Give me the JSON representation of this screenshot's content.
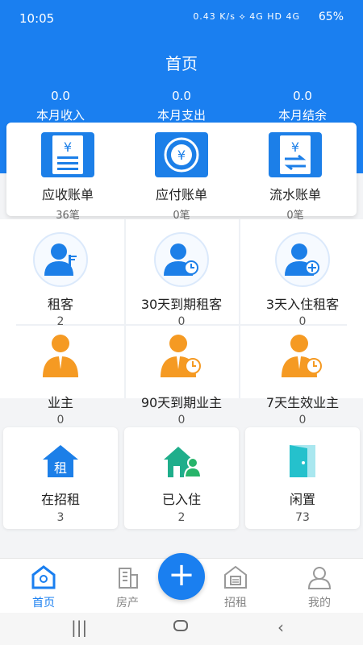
{
  "status_bar": {
    "time": "10:05",
    "indicators": "0.43 K/s ⟡ 4G HD 4G ",
    "battery": "65%"
  },
  "header": {
    "title": "首页"
  },
  "summary": [
    {
      "value": "0.0",
      "label": "本月收入"
    },
    {
      "value": "0.0",
      "label": "本月支出"
    },
    {
      "value": "0.0",
      "label": "本月结余"
    }
  ],
  "bills": [
    {
      "label": "应收账单",
      "count": "36笔",
      "icon": "receivable-bill-icon"
    },
    {
      "label": "应付账单",
      "count": "0笔",
      "icon": "payable-bill-icon"
    },
    {
      "label": "流水账单",
      "count": "0笔",
      "icon": "flow-bill-icon"
    }
  ],
  "tenants": [
    {
      "label": "租客",
      "count": "2"
    },
    {
      "label": "30天到期租客",
      "count": "0"
    },
    {
      "label": "3天入住租客",
      "count": "0"
    }
  ],
  "owners": [
    {
      "label": "业主",
      "count": "0"
    },
    {
      "label": "90天到期业主",
      "count": "0"
    },
    {
      "label": "7天生效业主",
      "count": "0"
    }
  ],
  "rooms": [
    {
      "label": "在招租",
      "count": "3",
      "icon_text": "租"
    },
    {
      "label": "已入住",
      "count": "2"
    },
    {
      "label": "闲置",
      "count": "73"
    }
  ],
  "nav": [
    {
      "label": "首页"
    },
    {
      "label": "房产"
    },
    {
      "label": "招租"
    },
    {
      "label": "我的"
    }
  ],
  "fab": "+",
  "colors": {
    "primary": "#1a7ff0",
    "orange": "#f59a23",
    "green": "#27b46a",
    "teal": "#25c1cc"
  }
}
